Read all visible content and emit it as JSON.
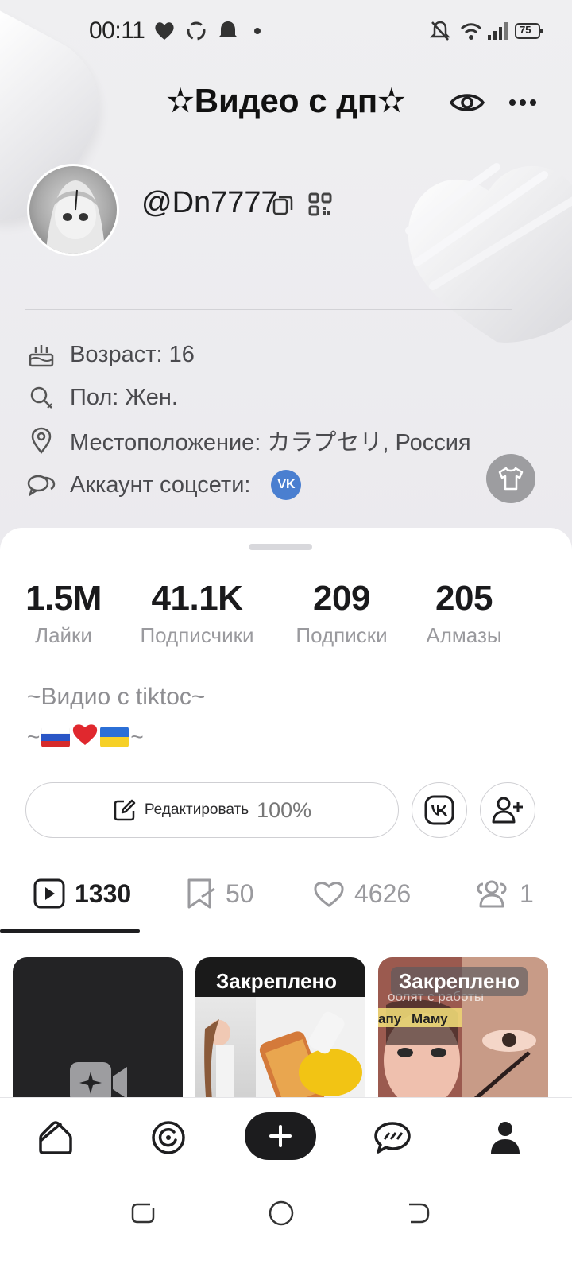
{
  "status_bar": {
    "time": "00:11",
    "battery": "75",
    "icons": [
      "heart-icon",
      "recycle-icon",
      "ghost-icon",
      "dot-icon",
      "mute-icon",
      "wifi-icon",
      "signal-icon",
      "battery-icon"
    ]
  },
  "header": {
    "title": "✫Видео с дп✫",
    "actions": [
      "eye-icon",
      "more-icon"
    ]
  },
  "profile": {
    "username": "@Dn7777",
    "info": {
      "age": "Возраст: 16",
      "gender": "Пол: Жен.",
      "location": "Местоположение: カラプセリ, Россия",
      "social": "Аккаунт соцсети:",
      "social_badge": "VK"
    }
  },
  "stats": [
    {
      "value": "1.5M",
      "label": "Лайки"
    },
    {
      "value": "41.1K",
      "label": "Подписчики"
    },
    {
      "value": "209",
      "label": "Подписки"
    },
    {
      "value": "205",
      "label": "Алмазы"
    }
  ],
  "bio": {
    "line1": "~Видио с tiktoc~",
    "line2_prefix": "~",
    "line2_suffix": "~"
  },
  "actions": {
    "edit_label": "Редактировать",
    "edit_percent": "100%"
  },
  "tabs": [
    {
      "icon": "video-icon",
      "count": "1330",
      "active": true
    },
    {
      "icon": "bookmark-icon",
      "count": "50",
      "active": false
    },
    {
      "icon": "heart-icon",
      "count": "4626",
      "active": false
    },
    {
      "icon": "friends-icon",
      "count": "1",
      "active": false
    }
  ],
  "grid": {
    "pinned_label": "Закреплено",
    "thumb3_texts": [
      "оолят с работы",
      "апу",
      "Маму"
    ]
  },
  "bottom_nav": [
    "home-icon",
    "explore-icon",
    "create-icon",
    "messages-icon",
    "profile-icon"
  ],
  "colors": {
    "accent": "#1c1c1e",
    "vk": "#4a7fd0",
    "muted_text": "#9a9a9e"
  }
}
